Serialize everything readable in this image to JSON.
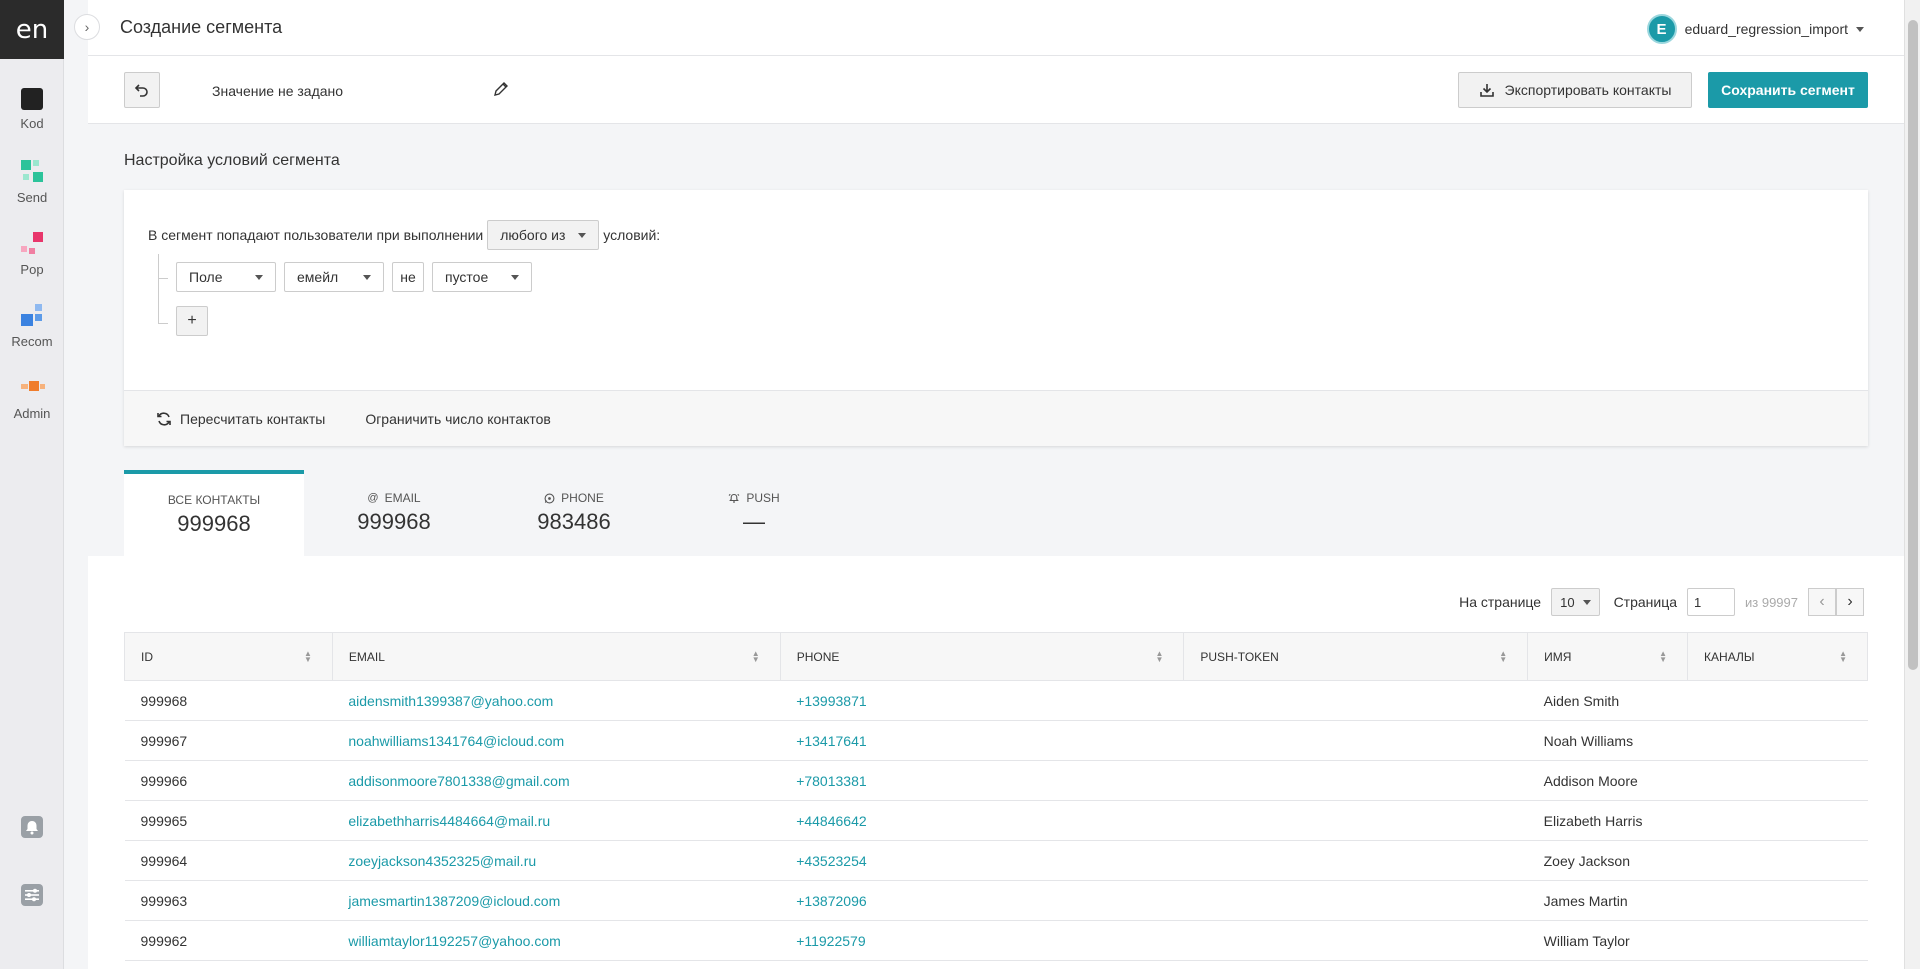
{
  "sidebar": {
    "logo": "en",
    "items": [
      {
        "label": "Kod",
        "icon": "kod-icon"
      },
      {
        "label": "Send",
        "icon": "send-icon"
      },
      {
        "label": "Pop",
        "icon": "pop-icon"
      },
      {
        "label": "Recom",
        "icon": "recom-icon"
      },
      {
        "label": "Admin",
        "icon": "admin-icon"
      }
    ],
    "bottom_icons": [
      "bell-icon",
      "settings-sliders-icon"
    ]
  },
  "header": {
    "title": "Создание сегмента",
    "user": {
      "initial": "E",
      "name": "eduard_regression_import"
    }
  },
  "toolbar": {
    "segment_name": "Значение не задано",
    "export_label": "Экспортировать контакты",
    "save_label": "Сохранить сегмент"
  },
  "conditions": {
    "section_title": "Настройка условий сегмента",
    "intro_text": "В сегмент попадают пользователи при выполнении",
    "match_mode": "любого из",
    "suffix_text": "условий:",
    "rule": {
      "field_type": "Поле",
      "field": "емейл",
      "negation": "не",
      "operator": "пустое"
    },
    "add_label": "+",
    "recalc_label": "Пересчитать контакты",
    "limit_label": "Ограничить число контактов"
  },
  "stats": [
    {
      "label": "Все контакты",
      "value": "999968",
      "icon": ""
    },
    {
      "label": "Email",
      "value": "999968",
      "icon": "at-icon"
    },
    {
      "label": "Phone",
      "value": "983486",
      "icon": "whatsapp-icon"
    },
    {
      "label": "Push",
      "value": "—",
      "icon": "bell-ring-icon"
    }
  ],
  "pagination": {
    "per_page_label": "На странице",
    "per_page_value": "10",
    "page_label": "Страница",
    "page_value": "1",
    "total_pages": "из 99997"
  },
  "table": {
    "columns": [
      "ID",
      "EMAIL",
      "PHONE",
      "PUSH-TOKEN",
      "ИМЯ",
      "КАНАЛЫ"
    ],
    "rows": [
      {
        "id": "999968",
        "email": "aidensmith1399387@yahoo.com",
        "phone": "+13993871",
        "push": "",
        "name": "Aiden Smith",
        "channels": ""
      },
      {
        "id": "999967",
        "email": "noahwilliams1341764@icloud.com",
        "phone": "+13417641",
        "push": "",
        "name": "Noah Williams",
        "channels": ""
      },
      {
        "id": "999966",
        "email": "addisonmoore7801338@gmail.com",
        "phone": "+78013381",
        "push": "",
        "name": "Addison Moore",
        "channels": ""
      },
      {
        "id": "999965",
        "email": "elizabethharris4484664@mail.ru",
        "phone": "+44846642",
        "push": "",
        "name": "Elizabeth Harris",
        "channels": ""
      },
      {
        "id": "999964",
        "email": "zoeyjackson4352325@mail.ru",
        "phone": "+43523254",
        "push": "",
        "name": "Zoey Jackson",
        "channels": ""
      },
      {
        "id": "999963",
        "email": "jamesmartin1387209@icloud.com",
        "phone": "+13872096",
        "push": "",
        "name": "James Martin",
        "channels": ""
      },
      {
        "id": "999962",
        "email": "williamtaylor1192257@yahoo.com",
        "phone": "+11922579",
        "push": "",
        "name": "William Taylor",
        "channels": ""
      }
    ]
  },
  "colors": {
    "accent": "#1b9aa8",
    "sidebar_bg": "#ececef",
    "logo_bg": "#2b2b2b"
  }
}
